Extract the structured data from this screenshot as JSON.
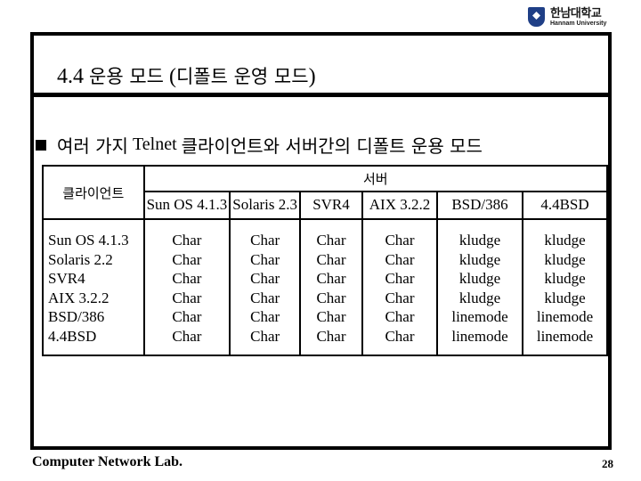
{
  "logo": {
    "korean": "한남대학교",
    "english": "Hannam University",
    "icon": "university-emblem-icon"
  },
  "slide": {
    "title_number": "4.4",
    "title_korean_1": "운용 모드",
    "title_paren_open": "(",
    "title_korean_2": "디폴트 운영 모드",
    "title_paren_close": ")",
    "bullet": {
      "icon": "square-bullet-icon",
      "text_kr_1": "여러 가지",
      "text_en": "Telnet",
      "text_kr_2": "클라이언트와 서버간의 디폴트 운용 모드"
    }
  },
  "table": {
    "client_header": "클라이언트",
    "server_header": "서버",
    "server_columns": [
      "Sun OS 4.1.3",
      "Solaris 2.3",
      "SVR4",
      "AIX 3.2.2",
      "BSD/386",
      "4.4BSD"
    ],
    "clients": [
      "Sun OS 4.1.3",
      "Solaris 2.2",
      "SVR4",
      "AIX 3.2.2",
      "BSD/386",
      "4.4BSD"
    ],
    "columns": [
      [
        "Char",
        "Char",
        "Char",
        "Char",
        "Char",
        "Char"
      ],
      [
        "Char",
        "Char",
        "Char",
        "Char",
        "Char",
        "Char"
      ],
      [
        "Char",
        "Char",
        "Char",
        "Char",
        "Char",
        "Char"
      ],
      [
        "Char",
        "Char",
        "Char",
        "Char",
        "Char",
        "Char"
      ],
      [
        "kludge",
        "kludge",
        "kludge",
        "kludge",
        "linemode",
        "linemode"
      ],
      [
        "kludge",
        "kludge",
        "kludge",
        "kludge",
        "linemode",
        "linemode"
      ]
    ]
  },
  "footer": {
    "lab": "Computer Network Lab.",
    "page_number": "28"
  }
}
